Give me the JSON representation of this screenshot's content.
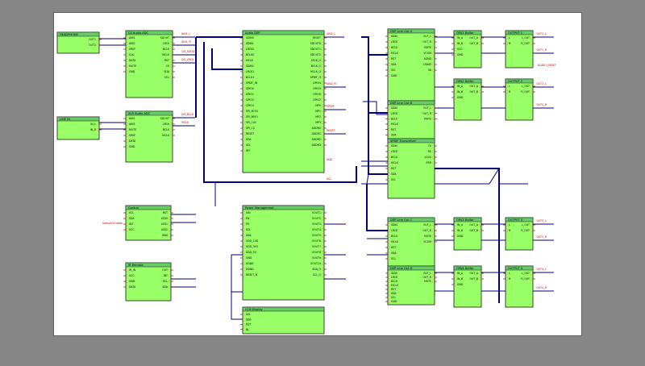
{
  "colors": {
    "backdrop": "#868686",
    "sheet": "#ffffff",
    "block_fill": "#99ff66",
    "block_header": "#66cc66",
    "block_border": "#1a1a1a",
    "wire": "#000080",
    "bus": "#000080",
    "red_label": "#c00000",
    "port_fill": "#ffff99"
  },
  "blocks": [
    {
      "id": "jack1",
      "title": "HEADPHONE",
      "pins_left": [],
      "pins_right": [
        "OUT1",
        "OUT2"
      ]
    },
    {
      "id": "jack2",
      "title": "LINE IN",
      "pins_left": [],
      "pins_right": [
        "IN_L",
        "IN_R"
      ]
    },
    {
      "id": "codec1",
      "title": "CS Audio ADC",
      "pins_left": [
        "AIN1",
        "AIN2",
        "VREF",
        "CLK",
        "DATA",
        "MUTE",
        "GND"
      ],
      "pins_right": [
        "SDOUT",
        "LRCK",
        "BCLK",
        "MCLK",
        "RST",
        "CS",
        "SDA",
        "SCL"
      ]
    },
    {
      "id": "codec2",
      "title": "XLR Audio ADC",
      "pins_left": [
        "AIN1",
        "AIN2",
        "MUTE",
        "VREF",
        "DATA",
        "GND"
      ],
      "pins_right": [
        "SDOUT",
        "LRCK",
        "BCLK",
        "MCLK"
      ]
    },
    {
      "id": "dsp",
      "title": "Audio DSP",
      "pins_left": [
        "SDIN0",
        "SDIN1",
        "LRCK0",
        "BCLK0",
        "MCLK",
        "SDIN2",
        "LRCK1",
        "BCLK1",
        "SPDIF_IN",
        "GPIO0",
        "GPIO1",
        "GPIO2",
        "GPIO3",
        "SPI_MOSI",
        "SPI_MISO",
        "SPI_CLK",
        "SPI_CS",
        "RESET",
        "SDA",
        "SCL",
        "INT"
      ],
      "pins_right": [
        "RESET",
        "SDOUT0",
        "SDOUT1",
        "SDOUT2",
        "LRCK_O",
        "BCLK_O",
        "MCLK_O",
        "SPDIF_O",
        "GPIO4",
        "GPIO5",
        "GPIO6",
        "GPIO7",
        "MP0",
        "MP1",
        "MP2",
        "MP3",
        "ADDR0",
        "ADDR1",
        "ADDR2",
        "ADDR3"
      ]
    },
    {
      "id": "dac1",
      "title": "DSP Line Out A",
      "pins_left": [
        "SDIN",
        "LRCK",
        "BCLK",
        "MCLK",
        "RST",
        "SDA",
        "SCL",
        "GND"
      ],
      "pins_right": [
        "OUT_L",
        "OUT_R",
        "MUTE",
        "VCOM",
        "AGND",
        "DGND",
        "VA"
      ]
    },
    {
      "id": "amp1",
      "title": "OPA1 Buffer",
      "pins_left": [
        "IN_A",
        "IN_B",
        "VCC",
        "GND"
      ],
      "pins_right": [
        "OUT_A",
        "OUT_B"
      ]
    },
    {
      "id": "out1",
      "title": "OUTPUT 1",
      "pins_left": [
        "L",
        "R"
      ],
      "pins_right": [
        "L_OUT",
        "R_OUT"
      ]
    },
    {
      "id": "dac2",
      "title": "DSP Line Out B",
      "pins_left": [
        "SDIN",
        "LRCK",
        "BCLK",
        "MCLK",
        "RST",
        "SDA"
      ],
      "pins_right": [
        "OUT_L",
        "OUT_R",
        "MUTE"
      ]
    },
    {
      "id": "amp2",
      "title": "OPA2 Buffer",
      "pins_left": [
        "IN_A",
        "IN_B",
        "GND"
      ],
      "pins_right": [
        "OUT_A",
        "OUT_B"
      ]
    },
    {
      "id": "out2",
      "title": "OUTPUT 2",
      "pins_left": [
        "L",
        "R"
      ],
      "pins_right": [
        "L_OUT",
        "R_OUT"
      ]
    },
    {
      "id": "spdif",
      "title": "SPDIF Transceiver",
      "pins_left": [
        "SDIN",
        "LRCK",
        "BCLK",
        "MCLK",
        "RST",
        "SDA",
        "SCL"
      ],
      "pins_right": [
        "TX",
        "RX",
        "LOCK",
        "ERR"
      ]
    },
    {
      "id": "ctrl",
      "title": "Control",
      "pins_left": [
        "SCL",
        "SDA",
        "INT",
        "VCC"
      ],
      "pins_right": [
        "RST",
        "LED0",
        "LED1",
        "LED2",
        "GND"
      ]
    },
    {
      "id": "sys",
      "title": "Power Management",
      "pins_left": [
        "VIN",
        "EN",
        "PG",
        "SCL",
        "SDA",
        "VDD_1V8",
        "VDD_3V3",
        "VDD_5V",
        "GND",
        "AGND",
        "DGND",
        "RESET_N"
      ],
      "pins_right": [
        "VOUT1",
        "VOUT2",
        "VOUT3",
        "VOUT4",
        "VOUT5",
        "VOUT6",
        "VOUT7",
        "VOUT8",
        "VOUT9",
        "VOUT10",
        "SDA_O",
        "SCL_O"
      ]
    },
    {
      "id": "dac3",
      "title": "DSP Line Out C",
      "pins_left": [
        "SDIN",
        "LRCK",
        "BCLK",
        "MCLK",
        "RST",
        "SDA",
        "SCL"
      ],
      "pins_right": [
        "OUT_L",
        "OUT_R",
        "MUTE",
        "VCOM"
      ]
    },
    {
      "id": "amp3",
      "title": "OPA3 Buffer",
      "pins_left": [
        "IN_A",
        "IN_B",
        "GND"
      ],
      "pins_right": [
        "OUT_A",
        "OUT_B"
      ]
    },
    {
      "id": "out3",
      "title": "OUTPUT 3",
      "pins_left": [
        "L",
        "R"
      ],
      "pins_right": [
        "L_OUT",
        "R_OUT"
      ]
    },
    {
      "id": "dac4",
      "title": "DSP Line Out D",
      "pins_left": [
        "SDIN",
        "LRCK",
        "BCLK",
        "MCLK",
        "RST",
        "SDA",
        "SCL",
        "GND"
      ],
      "pins_right": [
        "OUT_L",
        "OUT_R",
        "MUTE"
      ]
    },
    {
      "id": "amp4",
      "title": "OPA4 Buffer",
      "pins_left": [
        "IN_A",
        "IN_B",
        "GND"
      ],
      "pins_right": [
        "OUT_A",
        "OUT_B"
      ]
    },
    {
      "id": "out4",
      "title": "OUTPUT 4",
      "pins_left": [
        "L",
        "R"
      ],
      "pins_right": [
        "L_OUT",
        "R_OUT"
      ]
    },
    {
      "id": "ir",
      "title": "IR Remote",
      "pins_left": [
        "IR_IN",
        "VCC",
        "GND",
        "DATA"
      ],
      "pins_right": [
        "OUT",
        "INT",
        "SCL",
        "SDA"
      ]
    },
    {
      "id": "lcd",
      "title": "LCD Display",
      "pins_left": [
        "SCL",
        "SDA",
        "RST",
        "BL"
      ],
      "pins_right": []
    }
  ],
  "net_labels": [
    "AIN1_L",
    "AIN1_R",
    "I2S_SDOUT",
    "I2S_LRCK",
    "I2S_BCLK",
    "MCLK",
    "AIN2_L",
    "AIN2_R",
    "SPDIF",
    "RESET",
    "SDA",
    "SCL",
    "OUT1_L",
    "OUT1_R",
    "OUT2_L",
    "OUT2_R",
    "OUT3_L",
    "OUT3_R",
    "OUT4_L",
    "OUT4_R",
    "AUDIO_RESET",
    "Sample Enable"
  ]
}
